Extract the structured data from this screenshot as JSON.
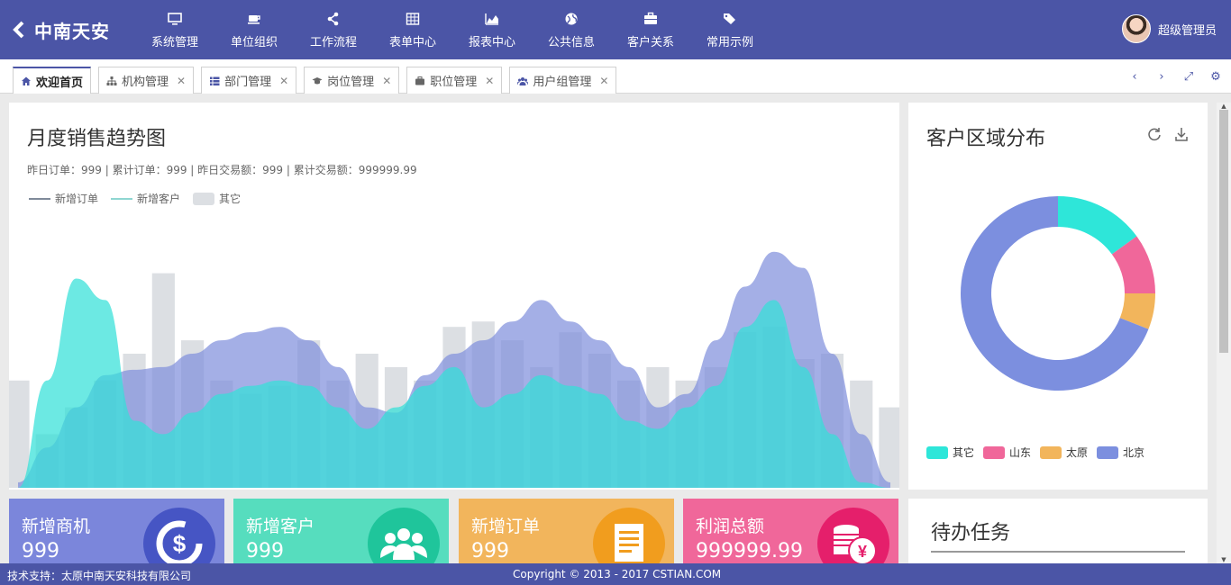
{
  "brand": {
    "name": "中南天安"
  },
  "nav": [
    {
      "label": "系统管理",
      "icon": "monitor-icon"
    },
    {
      "label": "单位组织",
      "icon": "coffee-cup-icon"
    },
    {
      "label": "工作流程",
      "icon": "share-icon"
    },
    {
      "label": "表单中心",
      "icon": "table-icon"
    },
    {
      "label": "报表中心",
      "icon": "area-chart-icon"
    },
    {
      "label": "公共信息",
      "icon": "globe-icon"
    },
    {
      "label": "客户关系",
      "icon": "briefcase-icon"
    },
    {
      "label": "常用示例",
      "icon": "tags-icon"
    }
  ],
  "user": {
    "name": "超级管理员"
  },
  "tabs": [
    {
      "label": "欢迎首页",
      "icon": "home-icon",
      "closable": false,
      "active": true
    },
    {
      "label": "机构管理",
      "icon": "sitemap-icon",
      "closable": true
    },
    {
      "label": "部门管理",
      "icon": "list-icon",
      "closable": true
    },
    {
      "label": "岗位管理",
      "icon": "graduation-cap-icon",
      "closable": true
    },
    {
      "label": "职位管理",
      "icon": "briefcase-icon",
      "closable": true
    },
    {
      "label": "用户组管理",
      "icon": "users-icon",
      "closable": true
    }
  ],
  "tab_controls": {
    "prev": "‹",
    "next": "›",
    "fullscreen": "⤢",
    "settings": "⚙"
  },
  "sales": {
    "title": "月度销售趋势图",
    "summary": "昨日订单：999 | 累计订单：999 | 昨日交易额：999 | 累计交易额：999999.99",
    "legend": [
      {
        "name": "新增订单",
        "color": "#7f8a9a"
      },
      {
        "name": "新增客户",
        "color": "#8fd6d1"
      },
      {
        "name": "其它",
        "color": "#dcdfe3"
      }
    ]
  },
  "chart_data": [
    {
      "type": "area",
      "series": [
        {
          "name": "其它",
          "kind": "bar",
          "values": [
            40,
            20,
            30,
            40,
            50,
            80,
            55,
            40,
            35,
            38,
            55,
            40,
            50,
            45,
            40,
            60,
            62,
            55,
            45,
            58,
            50,
            40,
            45,
            40,
            45,
            58,
            60,
            48,
            50,
            40,
            30
          ]
        },
        {
          "name": "新增订单",
          "kind": "area",
          "values": [
            2,
            15,
            30,
            42,
            44,
            45,
            50,
            55,
            58,
            60,
            55,
            45,
            30,
            28,
            42,
            50,
            55,
            62,
            70,
            62,
            55,
            45,
            30,
            35,
            55,
            75,
            88,
            82,
            50,
            20,
            2
          ]
        },
        {
          "name": "新增客户",
          "kind": "area",
          "values": [
            0,
            40,
            78,
            70,
            25,
            20,
            28,
            35,
            38,
            40,
            38,
            30,
            22,
            30,
            38,
            45,
            30,
            35,
            42,
            38,
            35,
            25,
            22,
            30,
            38,
            60,
            70,
            45,
            20,
            2,
            0
          ]
        }
      ],
      "ylim": [
        0,
        100
      ]
    },
    {
      "type": "pie",
      "title": "客户区域分布",
      "series": [
        {
          "name": "其它",
          "value": 15,
          "color": "#2ee6d9"
        },
        {
          "name": "山东",
          "value": 10,
          "color": "#f0679a"
        },
        {
          "name": "太原",
          "value": 6,
          "color": "#f2b55c"
        },
        {
          "name": "北京",
          "value": 69,
          "color": "#7c8fdf"
        }
      ]
    }
  ],
  "region": {
    "title": "客户区域分布"
  },
  "stats": [
    {
      "label": "新增商机",
      "value": "999",
      "color": "#7b86db",
      "icon": "dollar-cycle-icon",
      "iconbg": "#4655c4"
    },
    {
      "label": "新增客户",
      "value": "999",
      "color": "#56ddbe",
      "icon": "people-group-icon",
      "iconbg": "#1fc59b"
    },
    {
      "label": "新增订单",
      "value": "999",
      "color": "#f2b55c",
      "icon": "document-icon",
      "iconbg": "#f19d1e"
    },
    {
      "label": "利润总额",
      "value": "999999.99",
      "color": "#f0679a",
      "icon": "coins-yen-icon",
      "iconbg": "#e51f6b"
    }
  ],
  "todo": {
    "title": "待办任务"
  },
  "footer": {
    "left": "技术支持：太原中南天安科技有限公司",
    "right": "Copyright © 2013 - 2017 CSTIAN.COM"
  }
}
